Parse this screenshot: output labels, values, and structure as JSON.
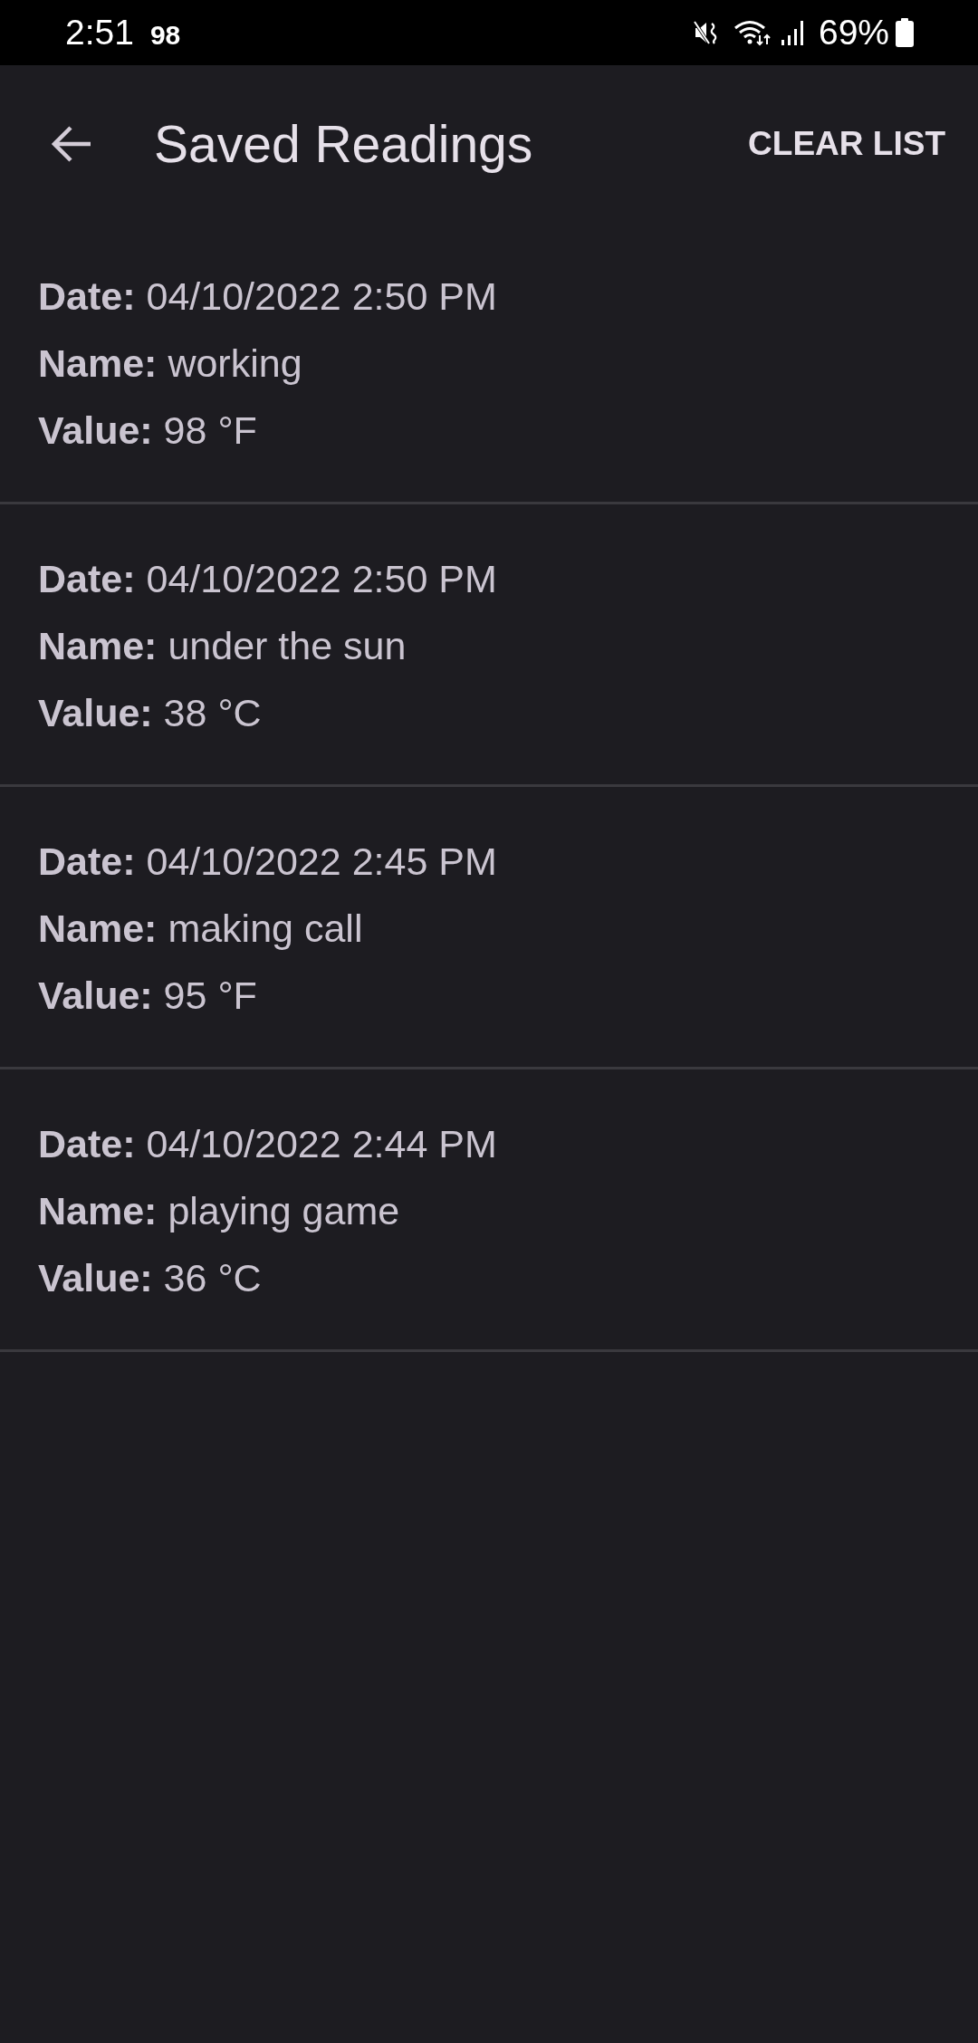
{
  "status_bar": {
    "time": "2:51",
    "notification": "98",
    "battery": "69%"
  },
  "app_bar": {
    "title": "Saved Readings",
    "action": "CLEAR LIST"
  },
  "readings": [
    {
      "date": "**Date:** 04/10/2022 2:50 PM",
      "name": "**Name:** working",
      "value": "**Value:** 98 °F"
    },
    {
      "date": "**Date:** 04/10/2022 2:50 PM",
      "name": "**Name:** under the sun",
      "value": "**Value:** 38 °C"
    },
    {
      "date": "**Date:** 04/10/2022 2:45 PM",
      "name": "**Name:** making call",
      "value": "**Value:** 95 °F"
    },
    {
      "date": "**Date:** 04/10/2022 2:44 PM",
      "name": "**Name:** playing game",
      "value": "**Value:** 36 °C"
    }
  ]
}
